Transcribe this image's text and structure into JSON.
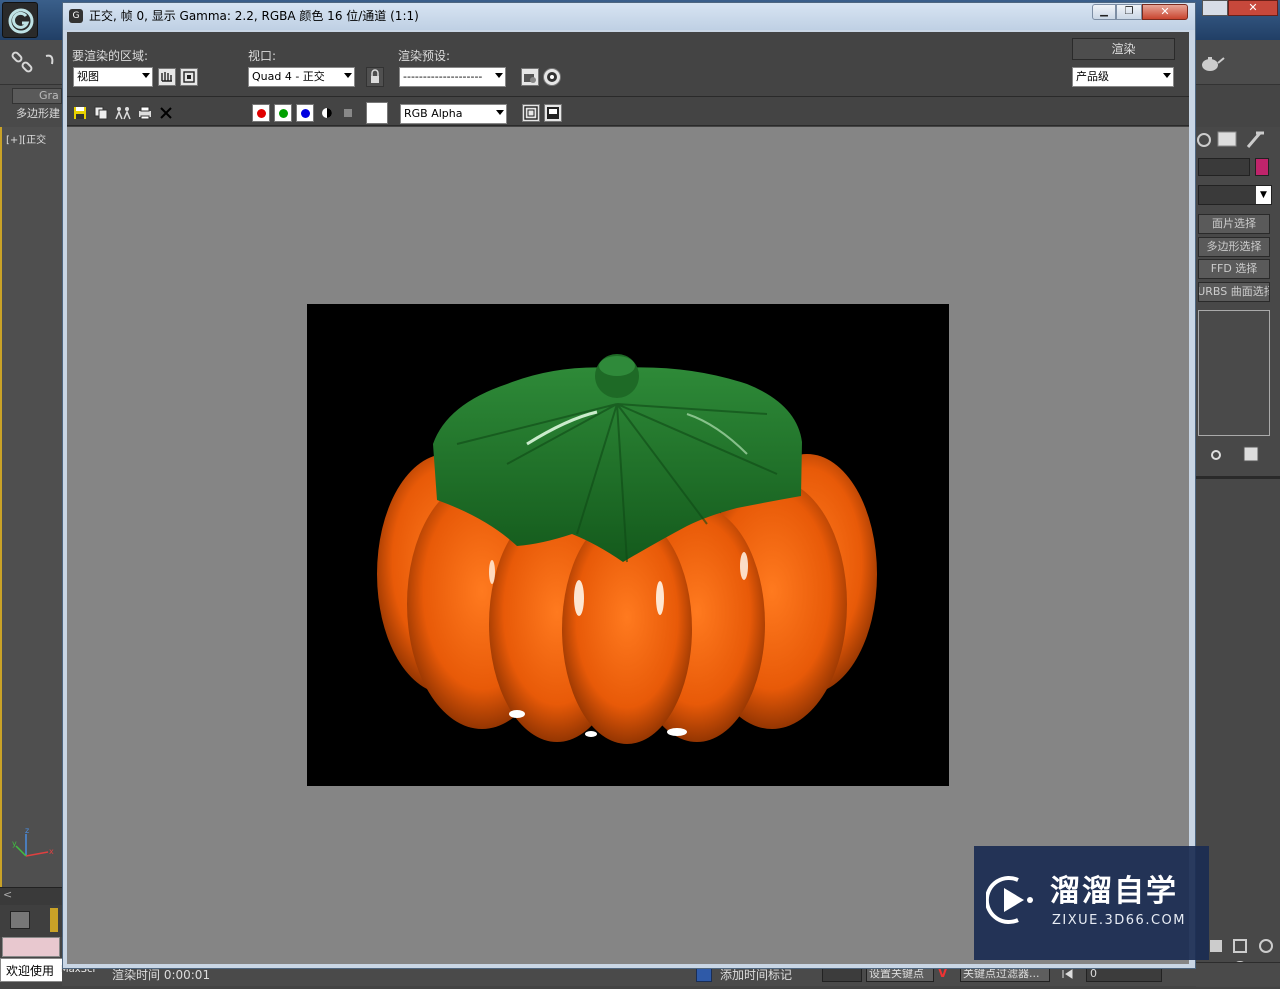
{
  "window": {
    "title": "正交, 帧 0, 显示 Gamma: 2.2, RGBA 颜色 16 位/通道 (1:1)",
    "icon": "3dsmax-logo-icon"
  },
  "controls": {
    "area_label": "要渲染的区域:",
    "area_value": "视图",
    "viewport_label": "视口:",
    "viewport_value": "Quad 4 - 正交",
    "preset_label": "渲染预设:",
    "preset_value": "--------------------",
    "render_button": "渲染",
    "quality_value": "产品级"
  },
  "toolbar2": {
    "channel_value": "RGB Alpha",
    "colors": {
      "red": "#e00000",
      "green": "#00a000",
      "blue": "#0000e0"
    }
  },
  "background_app": {
    "left_tab_1": "Gra",
    "left_tab_2": "多边形建",
    "viewport_label": "[+][正交",
    "axis": {
      "x": "x",
      "y": "y",
      "z": "z"
    },
    "scroll_marker": "<",
    "right_buttons": [
      "面片选择",
      "多边形选择",
      "FFD 选择",
      "NURBS 曲面选择"
    ],
    "welcome": "欢迎使用",
    "maxscript": "MaxScr",
    "status_text": "渲染时间 0:00:01",
    "add_time_tag": "添加时间标记",
    "set_key": "设置关键点",
    "key_filter": "关键点过滤器...",
    "v_mark": "V",
    "frame_value": "0",
    "accent_color": "#c9a227",
    "swatch_color": "#c0246b"
  },
  "watermark": {
    "title": "溜溜自学",
    "url": "ZIXUE.3D66.COM"
  },
  "render": {
    "subject": "orange pumpkin with green lid",
    "background": "#000000",
    "body_color": "#e9580a",
    "lid_color": "#1e6a26"
  }
}
